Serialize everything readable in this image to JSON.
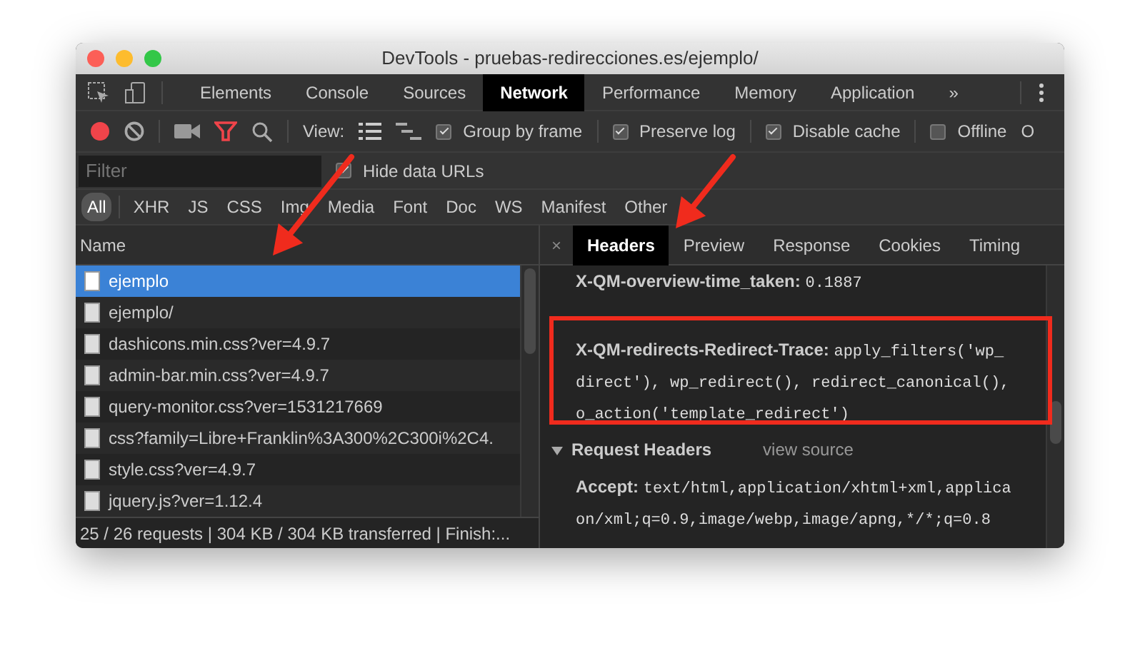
{
  "window": {
    "title": "DevTools - pruebas-redirecciones.es/ejemplo/"
  },
  "main_tabs": [
    {
      "label": "Elements",
      "selected": false
    },
    {
      "label": "Console",
      "selected": false
    },
    {
      "label": "Sources",
      "selected": false
    },
    {
      "label": "Network",
      "selected": true
    },
    {
      "label": "Performance",
      "selected": false
    },
    {
      "label": "Memory",
      "selected": false
    },
    {
      "label": "Application",
      "selected": false
    }
  ],
  "more_tabs": "»",
  "toolbar": {
    "recording": true,
    "filter_active": true,
    "view_label": "View:",
    "options": [
      {
        "label": "Group by frame",
        "checked": true
      },
      {
        "label": "Preserve log",
        "checked": true
      },
      {
        "label": "Disable cache",
        "checked": true
      },
      {
        "label": "Offline",
        "checked": false
      }
    ],
    "cut_text": "O"
  },
  "filter": {
    "placeholder": "Filter"
  },
  "hide_data_urls": {
    "label": "Hide data URLs",
    "checked": true
  },
  "type_filters": [
    {
      "label": "All",
      "selected": true
    },
    {
      "label": "XHR",
      "selected": false
    },
    {
      "label": "JS",
      "selected": false
    },
    {
      "label": "CSS",
      "selected": false
    },
    {
      "label": "Img",
      "selected": false
    },
    {
      "label": "Media",
      "selected": false
    },
    {
      "label": "Font",
      "selected": false
    },
    {
      "label": "Doc",
      "selected": false
    },
    {
      "label": "WS",
      "selected": false
    },
    {
      "label": "Manifest",
      "selected": false
    },
    {
      "label": "Other",
      "selected": false
    }
  ],
  "requests": {
    "column": "Name",
    "rows": [
      {
        "name": "ejemplo",
        "selected": true
      },
      {
        "name": "ejemplo/",
        "selected": false
      },
      {
        "name": "dashicons.min.css?ver=4.9.7",
        "selected": false
      },
      {
        "name": "admin-bar.min.css?ver=4.9.7",
        "selected": false
      },
      {
        "name": "query-monitor.css?ver=1531217669",
        "selected": false
      },
      {
        "name": "css?family=Libre+Franklin%3A300%2C300i%2C4.",
        "selected": false
      },
      {
        "name": "style.css?ver=4.9.7",
        "selected": false
      },
      {
        "name": "jquery.js?ver=1.12.4",
        "selected": false
      }
    ],
    "summary": "25 / 26 requests | 304 KB / 304 KB transferred | Finish:..."
  },
  "details": {
    "close": "×",
    "tabs": [
      {
        "label": "Headers",
        "selected": true
      },
      {
        "label": "Preview",
        "selected": false
      },
      {
        "label": "Response",
        "selected": false
      },
      {
        "label": "Cookies",
        "selected": false
      },
      {
        "label": "Timing",
        "selected": false
      }
    ],
    "response_headers": [
      {
        "name": "X-QM-overview-time_taken:",
        "lines": [
          "0.1887"
        ]
      },
      {
        "name": "X-QM-redirects-Redirect-Trace:",
        "lines": [
          "apply_filters('wp_",
          "direct'), wp_redirect(), redirect_canonical(),",
          "o_action('template_redirect')"
        ]
      }
    ],
    "request_headers": {
      "title": "Request Headers",
      "expanded": true,
      "view_source": "view source",
      "items": [
        {
          "name": "Accept:",
          "lines": [
            "text/html,application/xhtml+xml,applica",
            "on/xml;q=0.9,image/webp,image/apng,*/*;q=0.8"
          ]
        }
      ]
    }
  }
}
